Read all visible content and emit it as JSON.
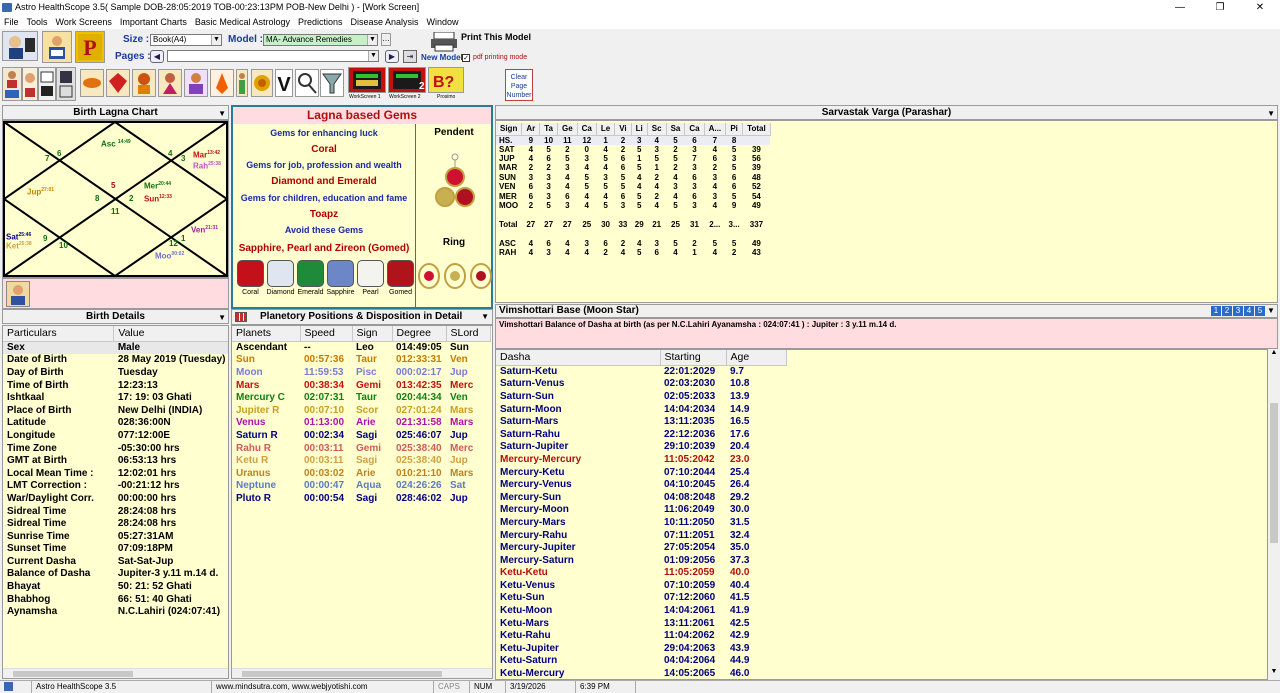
{
  "window": {
    "title": "Astro HealthScope 3.5( Sample DOB-28:05:2019 TOB-00:23:13PM POB-New Delhi ) - [Work Screen]",
    "minimize": "—",
    "restore": "❐",
    "close": "✕"
  },
  "menu": [
    "File",
    "Tools",
    "Work Screens",
    "Important Charts",
    "Basic Medical Astrology",
    "Predictions",
    "Disease Analysis",
    "Window"
  ],
  "toolbar": {
    "size_label": "Size :",
    "size_value": "Book(A4)",
    "model_label": "Model :",
    "model_value": "MA- Advance Remedies",
    "pages_label": "Pages :",
    "new_model": "New Model",
    "print_model": "Print This Model",
    "pdf_mode": "pdf printing mode",
    "ws1": "WorkScreen 1",
    "ws2": "WorkScreen 2",
    "prosimo": "Prosimo",
    "clear_page": "Clear Page Number"
  },
  "birth_chart": {
    "title": "Birth Lagna Chart",
    "houses": [
      "7",
      "6",
      "4",
      "3",
      "5",
      "2",
      "8",
      "11",
      "9",
      "10",
      "12",
      "1"
    ],
    "planets": {
      "asc": "Asc",
      "asc_deg": "14:49",
      "mar": "Mar",
      "mar_deg": "13:42",
      "rah": "Rah",
      "rah_deg": "25:38",
      "jup": "Jup",
      "jup_deg": "27:01",
      "mer": "Mer",
      "mer_deg": "20:44",
      "sun": "Sun",
      "sun_deg": "12:33",
      "ven": "Ven",
      "ven_deg": "21:31",
      "sat": "Sat",
      "sat_deg": "25:46",
      "ket": "Ket",
      "ket_deg": "25:38",
      "moo": "Moo",
      "moo_deg": "00:02"
    }
  },
  "gems": {
    "title": "Lagna based Gems",
    "luck": "Gems for enhancing luck",
    "coral": "Coral",
    "job": "Gems for job, profession and wealth",
    "diamond_emerald": "Diamond and Emerald",
    "children": "Gems for children, education and fame",
    "topaz": "Toapz",
    "avoid": "Avoid these Gems",
    "avoid_list": "Sapphire, Pearl and Zireon (Gomed)",
    "pendent": "Pendent",
    "ring": "Ring",
    "stones": [
      {
        "name": "Coral",
        "color": "#c4101a"
      },
      {
        "name": "Diamond",
        "color": "#dfe6f0"
      },
      {
        "name": "Emerald",
        "color": "#1f8a3a"
      },
      {
        "name": "Sapphire",
        "color": "#6d86c6"
      },
      {
        "name": "Pearl",
        "color": "#f4f4ee"
      },
      {
        "name": "Gomed",
        "color": "#b0141a"
      }
    ]
  },
  "sarvastak": {
    "title": "Sarvastak Varga (Parashar)",
    "headers": [
      "Sign",
      "Ar",
      "Ta",
      "Ge",
      "Ca",
      "Le",
      "Vi",
      "Li",
      "Sc",
      "Sa",
      "Ca",
      "A...",
      "Pi",
      "Total"
    ],
    "rows": [
      [
        "HS.",
        "9",
        "10",
        "11",
        "12",
        "1",
        "2",
        "3",
        "4",
        "5",
        "6",
        "7",
        "8",
        ""
      ],
      [
        "SAT",
        "4",
        "5",
        "2",
        "0",
        "4",
        "2",
        "5",
        "3",
        "2",
        "3",
        "4",
        "5",
        "39"
      ],
      [
        "JUP",
        "4",
        "6",
        "5",
        "3",
        "5",
        "6",
        "1",
        "5",
        "5",
        "7",
        "6",
        "3",
        "56"
      ],
      [
        "MAR",
        "2",
        "2",
        "3",
        "4",
        "4",
        "6",
        "5",
        "1",
        "2",
        "3",
        "2",
        "5",
        "39"
      ],
      [
        "SUN",
        "3",
        "3",
        "4",
        "5",
        "3",
        "5",
        "4",
        "2",
        "4",
        "6",
        "3",
        "6",
        "48"
      ],
      [
        "VEN",
        "6",
        "3",
        "4",
        "5",
        "5",
        "5",
        "4",
        "4",
        "3",
        "3",
        "4",
        "6",
        "52"
      ],
      [
        "MER",
        "6",
        "3",
        "6",
        "4",
        "4",
        "6",
        "5",
        "2",
        "4",
        "6",
        "3",
        "5",
        "54"
      ],
      [
        "MOO",
        "2",
        "5",
        "3",
        "4",
        "5",
        "3",
        "5",
        "4",
        "5",
        "3",
        "4",
        "9",
        "49"
      ],
      [
        "",
        "",
        "",
        "",
        "",
        "",
        "",
        "",
        "",
        "",
        "",
        "",
        "",
        ""
      ],
      [
        "Total",
        "27",
        "27",
        "27",
        "25",
        "30",
        "33",
        "29",
        "21",
        "25",
        "31",
        "2...",
        "3...",
        "337"
      ],
      [
        "",
        "",
        "",
        "",
        "",
        "",
        "",
        "",
        "",
        "",
        "",
        "",
        "",
        ""
      ],
      [
        "ASC",
        "4",
        "6",
        "4",
        "3",
        "6",
        "2",
        "4",
        "3",
        "5",
        "2",
        "5",
        "5",
        "49"
      ],
      [
        "RAH",
        "4",
        "3",
        "4",
        "4",
        "2",
        "4",
        "5",
        "6",
        "4",
        "1",
        "4",
        "2",
        "43"
      ]
    ]
  },
  "birth_details": {
    "title": "Birth Details",
    "col1": "Particulars",
    "col2": "Value",
    "rows": [
      [
        "Sex",
        "Male"
      ],
      [
        "Date of Birth",
        "28 May 2019 (Tuesday)"
      ],
      [
        "Day of Birth",
        "Tuesday"
      ],
      [
        "Time of Birth",
        "12:23:13"
      ],
      [
        "Ishtkaal",
        "17: 19: 03 Ghati"
      ],
      [
        "Place of Birth",
        "New Delhi (INDIA)"
      ],
      [
        "Latitude",
        "028:36:00N"
      ],
      [
        "Longitude",
        "077:12:00E"
      ],
      [
        "Time Zone",
        "-05:30:00 hrs"
      ],
      [
        "GMT at Birth",
        "06:53:13 hrs"
      ],
      [
        "Local Mean Time :",
        "12:02:01 hrs"
      ],
      [
        "LMT Correction :",
        "-00:21:12 hrs"
      ],
      [
        "War/Daylight Corr.",
        "00:00:00 hrs"
      ],
      [
        "Sidreal Time",
        "28:24:08 hrs"
      ],
      [
        "Sidreal Time",
        "28:24:08 hrs"
      ],
      [
        "Sunrise Time",
        "05:27:31AM"
      ],
      [
        "Sunset Time",
        "07:09:18PM"
      ],
      [
        "Current Dasha",
        "Sat-Sat-Jup"
      ],
      [
        "Balance of Dasha",
        "Jupiter-3 y.11 m.14 d."
      ],
      [
        "Bhayat",
        "50: 21: 52 Ghati"
      ],
      [
        "Bhabhog",
        "66: 51: 40 Ghati"
      ],
      [
        "Aynamsha",
        "N.C.Lahiri (024:07:41)"
      ]
    ]
  },
  "planetary": {
    "title": "Planetory Positions & Disposition in Detail",
    "headers": [
      "Planets",
      "Speed",
      "Sign",
      "Degree",
      "SLord"
    ],
    "rows": [
      {
        "p": "Ascendant",
        "s": "--",
        "g": "Leo",
        "d": "014:49:05",
        "l": "Sun",
        "c": "#000000"
      },
      {
        "p": "Sun",
        "s": "00:57:36",
        "g": "Taur",
        "d": "012:33:31",
        "l": "Ven",
        "c": "#c87a00"
      },
      {
        "p": "Moon",
        "s": "11:59:53",
        "g": "Pisc",
        "d": "000:02:17",
        "l": "Jup",
        "c": "#7a7ad8"
      },
      {
        "p": "Mars",
        "s": "00:38:34",
        "g": "Gemi",
        "d": "013:42:35",
        "l": "Merc",
        "c": "#c81010"
      },
      {
        "p": "Mercury C",
        "s": "02:07:31",
        "g": "Taur",
        "d": "020:44:34",
        "l": "Ven",
        "c": "#108010"
      },
      {
        "p": "Jupiter R",
        "s": "00:07:10",
        "g": "Scor",
        "d": "027:01:24",
        "l": "Mars",
        "c": "#c8a020"
      },
      {
        "p": "Venus",
        "s": "01:13:00",
        "g": "Arie",
        "d": "021:31:58",
        "l": "Mars",
        "c": "#b010b0"
      },
      {
        "p": "Saturn R",
        "s": "00:02:34",
        "g": "Sagi",
        "d": "025:46:07",
        "l": "Jup",
        "c": "#000080"
      },
      {
        "p": "Rahu R",
        "s": "00:03:11",
        "g": "Gemi",
        "d": "025:38:40",
        "l": "Merc",
        "c": "#d05a5a"
      },
      {
        "p": "Ketu R",
        "s": "00:03:11",
        "g": "Sagi",
        "d": "025:38:40",
        "l": "Jup",
        "c": "#d0a040"
      },
      {
        "p": "Uranus",
        "s": "00:03:02",
        "g": "Arie",
        "d": "010:21:10",
        "l": "Mars",
        "c": "#c08020"
      },
      {
        "p": "Neptune",
        "s": "00:00:47",
        "g": "Aqua",
        "d": "024:26:26",
        "l": "Sat",
        "c": "#5a7ac8"
      },
      {
        "p": "Pluto R",
        "s": "00:00:54",
        "g": "Sagi",
        "d": "028:46:02",
        "l": "Jup",
        "c": "#000080"
      }
    ]
  },
  "vimshottari": {
    "title": "Vimshottari Base (Moon Star)",
    "tabs": [
      "1",
      "2",
      "3",
      "4",
      "5"
    ],
    "balance": "Vimshottari Balance of Dasha at birth (as per N.C.Lahiri Ayanamsha : 024:07:41 ) : Jupiter  :  3 y.11 m.14 d.",
    "headers": [
      "Dasha",
      "Starting",
      "Age"
    ],
    "rows": [
      [
        "Saturn-Ketu",
        "22:01:2029",
        "9.7",
        0
      ],
      [
        "Saturn-Venus",
        "02:03:2030",
        "10.8",
        0
      ],
      [
        "Saturn-Sun",
        "02:05:2033",
        "13.9",
        0
      ],
      [
        "Saturn-Moon",
        "14:04:2034",
        "14.9",
        0
      ],
      [
        "Saturn-Mars",
        "13:11:2035",
        "16.5",
        0
      ],
      [
        "Saturn-Rahu",
        "22:12:2036",
        "17.6",
        0
      ],
      [
        "Saturn-Jupiter",
        "29:10:2039",
        "20.4",
        0
      ],
      [
        "Mercury-Mercury",
        "11:05:2042",
        "23.0",
        1
      ],
      [
        "Mercury-Ketu",
        "07:10:2044",
        "25.4",
        0
      ],
      [
        "Mercury-Venus",
        "04:10:2045",
        "26.4",
        0
      ],
      [
        "Mercury-Sun",
        "04:08:2048",
        "29.2",
        0
      ],
      [
        "Mercury-Moon",
        "11:06:2049",
        "30.0",
        0
      ],
      [
        "Mercury-Mars",
        "10:11:2050",
        "31.5",
        0
      ],
      [
        "Mercury-Rahu",
        "07:11:2051",
        "32.4",
        0
      ],
      [
        "Mercury-Jupiter",
        "27:05:2054",
        "35.0",
        0
      ],
      [
        "Mercury-Saturn",
        "01:09:2056",
        "37.3",
        0
      ],
      [
        "Ketu-Ketu",
        "11:05:2059",
        "40.0",
        1
      ],
      [
        "Ketu-Venus",
        "07:10:2059",
        "40.4",
        0
      ],
      [
        "Ketu-Sun",
        "07:12:2060",
        "41.5",
        0
      ],
      [
        "Ketu-Moon",
        "14:04:2061",
        "41.9",
        0
      ],
      [
        "Ketu-Mars",
        "13:11:2061",
        "42.5",
        0
      ],
      [
        "Ketu-Rahu",
        "11:04:2062",
        "42.9",
        0
      ],
      [
        "Ketu-Jupiter",
        "29:04:2063",
        "43.9",
        0
      ],
      [
        "Ketu-Saturn",
        "04:04:2064",
        "44.9",
        0
      ],
      [
        "Ketu-Mercury",
        "14:05:2065",
        "46.0",
        0
      ]
    ]
  },
  "status": {
    "app": "Astro HealthScope 3.5",
    "web": "www.mindsutra.com, www.webjyotishi.com",
    "caps": "CAPS",
    "num": "NUM",
    "date": "3/19/2026",
    "time": "6:39 PM"
  }
}
